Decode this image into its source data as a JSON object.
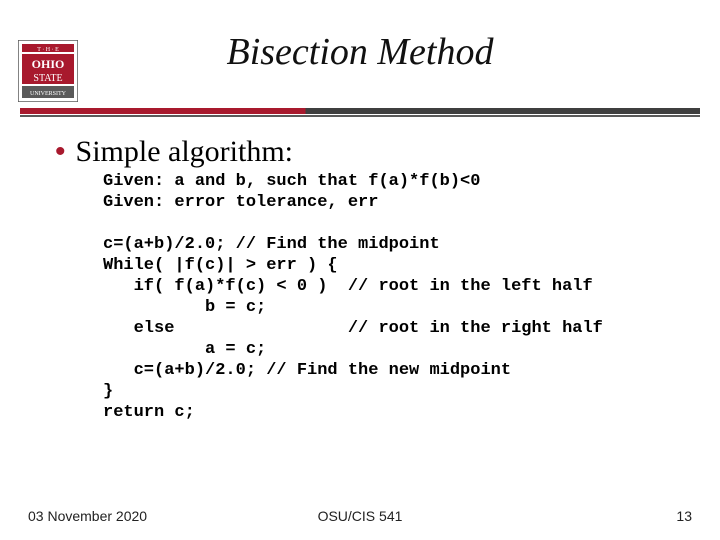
{
  "slide": {
    "title": "Bisection Method",
    "bullet": "Simple algorithm:",
    "code": "Given: a and b, such that f(a)*f(b)<0\nGiven: error tolerance, err\n\nc=(a+b)/2.0; // Find the midpoint\nWhile( |f(c)| > err ) {\n   if( f(a)*f(c) < 0 )  // root in the left half\n          b = c;\n   else                 // root in the right half\n          a = c;\n   c=(a+b)/2.0; // Find the new midpoint\n}\nreturn c;"
  },
  "footer": {
    "date": "03 November 2020",
    "center": "OSU/CIS 541",
    "page": "13"
  },
  "logo": {
    "top_text": "T · H · E",
    "mid_text": "OHIO",
    "mid2_text": "STATE",
    "bot_text": "UNIVERSITY"
  }
}
